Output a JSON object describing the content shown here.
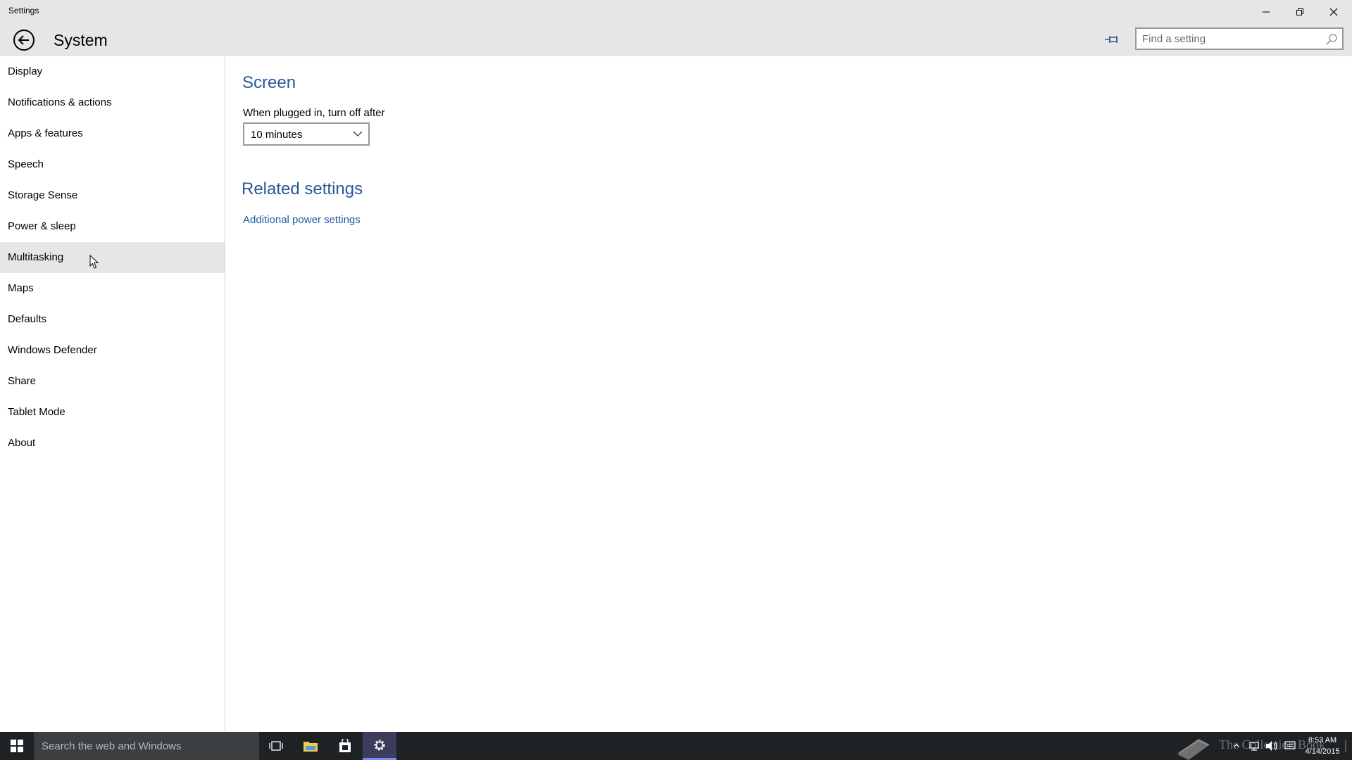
{
  "window": {
    "app_title": "Settings",
    "page_title": "System",
    "search": {
      "placeholder": "Find a setting"
    }
  },
  "sidebar": {
    "items": [
      {
        "label": "Display"
      },
      {
        "label": "Notifications & actions"
      },
      {
        "label": "Apps & features"
      },
      {
        "label": "Speech"
      },
      {
        "label": "Storage Sense"
      },
      {
        "label": "Power & sleep"
      },
      {
        "label": "Multitasking"
      },
      {
        "label": "Maps"
      },
      {
        "label": "Defaults"
      },
      {
        "label": "Windows Defender"
      },
      {
        "label": "Share"
      },
      {
        "label": "Tablet Mode"
      },
      {
        "label": "About"
      }
    ]
  },
  "main": {
    "screen_section": {
      "title": "Screen",
      "plugged_in_label": "When plugged in, turn off after",
      "plugged_in_value": "10 minutes"
    },
    "related_section": {
      "title": "Related settings",
      "link": "Additional power settings"
    }
  },
  "taskbar": {
    "search_placeholder": "Search the web and Windows",
    "watermark": "The Collection Book",
    "time": "8:53 AM",
    "date": "4/14/2015"
  },
  "colors": {
    "accent": "#2b5797",
    "link": "#1f5fa6",
    "header_bg": "#e6e6e6",
    "taskbar_bg": "#1e2225",
    "hover_bg": "#e6e6e6"
  }
}
